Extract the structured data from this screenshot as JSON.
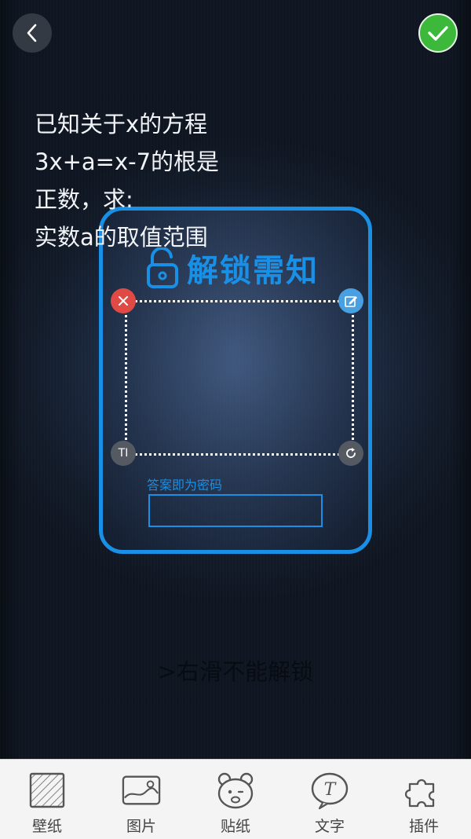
{
  "header": {
    "back_icon": "chevron-left-icon",
    "confirm_icon": "checkmark-icon"
  },
  "card": {
    "lock_icon": "unlock-icon",
    "title": "解锁需知",
    "question": "已知关于x的方程\n3x+a=x-7的根是\n正数，求:\n实数a的取值范围",
    "corner_font_label": "TI",
    "answer_label": "答案即为密码",
    "answer_value": ""
  },
  "slide_hint": ">右滑不能解锁",
  "toolbar": {
    "items": [
      {
        "label": "壁纸",
        "icon": "wallpaper-icon"
      },
      {
        "label": "图片",
        "icon": "picture-icon"
      },
      {
        "label": "贴纸",
        "icon": "sticker-bear-icon"
      },
      {
        "label": "文字",
        "icon": "text-icon"
      },
      {
        "label": "插件",
        "icon": "plugin-puzzle-icon"
      }
    ]
  },
  "colors": {
    "accent": "#1a8fe6",
    "confirm_green": "#3cb83a",
    "delete_red": "#e04a44",
    "edit_blue": "#4a9fe0"
  }
}
